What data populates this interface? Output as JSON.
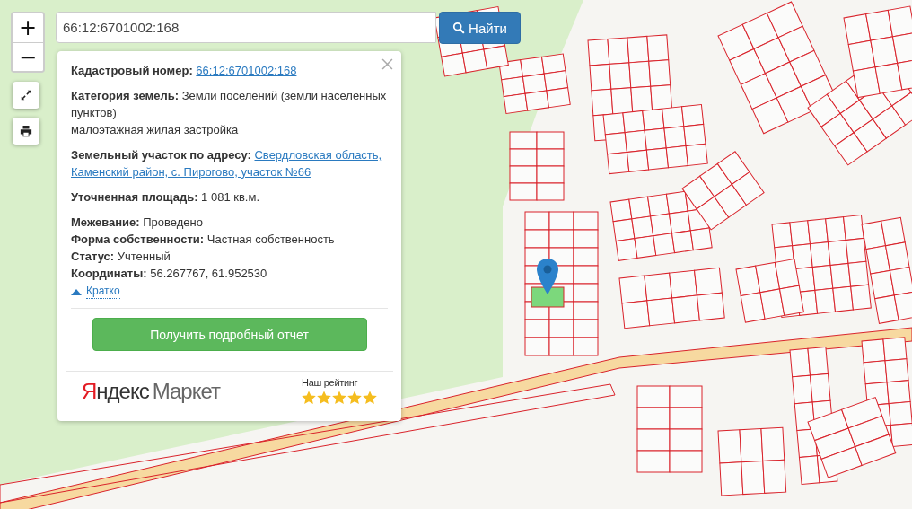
{
  "map_controls": {
    "zoom_in": "+",
    "zoom_out": "−"
  },
  "search": {
    "value": "66:12:6701002:168",
    "button": "Найти"
  },
  "info_card": {
    "groups": [
      [
        {
          "label": "Кадастровый номер:",
          "value": "66:12:6701002:168",
          "kind": "link"
        }
      ],
      [
        {
          "label": "Категория земель:",
          "value": "Земли поселений (земли населенных пунктов)",
          "kind": "text"
        },
        {
          "value": "малоэтажная жилая застройка",
          "kind": "text"
        }
      ],
      [
        {
          "label": "Земельный участок по адресу:",
          "value": [
            "Свердловская область,",
            "Каменский район, с. Пирогово, участок №66"
          ],
          "kind": "link"
        }
      ],
      [
        {
          "label": "Уточненная площадь:",
          "value": "1 081 кв.м.",
          "kind": "text"
        }
      ],
      [
        {
          "label": "Межевание:",
          "value": "Проведено",
          "kind": "text"
        },
        {
          "label": "Форма собственности:",
          "value": "Частная собственность",
          "kind": "text"
        },
        {
          "label": "Статус:",
          "value": "Учтенный",
          "kind": "text"
        },
        {
          "label": "Координаты:",
          "value": "56.267767, 61.952530",
          "kind": "text"
        }
      ]
    ],
    "toggle": "Кратко",
    "report_button": "Получить подробный отчет",
    "rating": {
      "logo": [
        "Яндекс",
        "Маркет"
      ],
      "label": "Наш рейтинг",
      "stars": 5
    }
  }
}
